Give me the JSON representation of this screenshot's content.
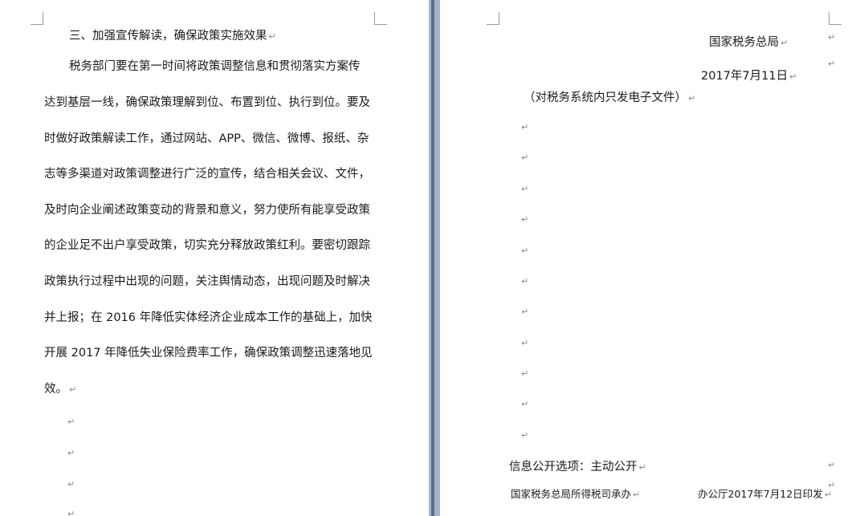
{
  "left_page": {
    "heading": "三、加强宣传解读，确保政策实施效果",
    "body_lines": [
      "税务部门要在第一时间将政策调整信息和贯彻落实方案传",
      "达到基层一线，确保政策理解到位、布置到位、执行到位。要及",
      "时做好政策解读工作，通过网站、APP、微信、微博、报纸、杂",
      "志等多渠道对政策调整进行广泛的宣传，结合相关会议、文件，",
      "及时向企业阐述政策变动的背景和意义，努力使所有能享受政策",
      "的企业足不出户享受政策，切实充分释放政策红利。要密切跟踪",
      "政策执行过程中出现的问题，关注舆情动态，出现问题及时解决",
      "并上报；在 2016 年降低实体经济企业成本工作的基础上，加快",
      "开展 2017 年降低失业保险费率工作，确保政策调整迅速落地见",
      "效。"
    ]
  },
  "right_page": {
    "issuer": "国家税务总局",
    "date": "2017年7月11日",
    "note": "（对税务系统内只发电子文件）",
    "disclosure": "信息公开选项：主动公开",
    "footer_left": "国家税务总局所得税司承办",
    "footer_right": "办公厅2017年7月12日印发"
  },
  "marks": {
    "paragraph": "↵"
  }
}
